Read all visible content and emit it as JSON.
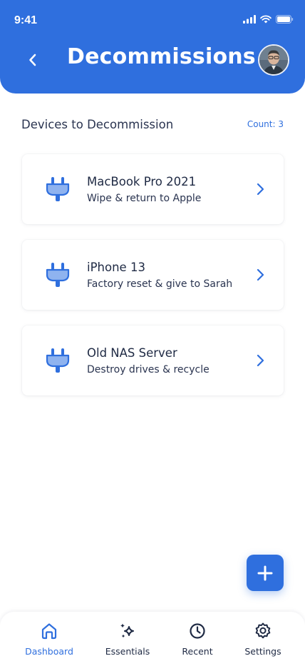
{
  "status_bar": {
    "time": "9:41"
  },
  "header": {
    "title": "Decommissions"
  },
  "section": {
    "title": "Devices to Decommission",
    "count_label": "Count: 3"
  },
  "devices": [
    {
      "name": "MacBook Pro 2021",
      "description": "Wipe & return to Apple"
    },
    {
      "name": "iPhone 13",
      "description": "Factory reset & give to Sarah"
    },
    {
      "name": "Old NAS Server",
      "description": "Destroy drives & recycle"
    }
  ],
  "nav": {
    "items": [
      {
        "label": "Dashboard",
        "icon": "home-icon",
        "active": true
      },
      {
        "label": "Essentials",
        "icon": "sparkle-icon",
        "active": false
      },
      {
        "label": "Recent",
        "icon": "clock-icon",
        "active": false
      },
      {
        "label": "Settings",
        "icon": "gear-icon",
        "active": false
      }
    ]
  },
  "colors": {
    "primary": "#2f6fde",
    "text": "#1f2a44",
    "icon_fill": "#8fb3ef"
  }
}
